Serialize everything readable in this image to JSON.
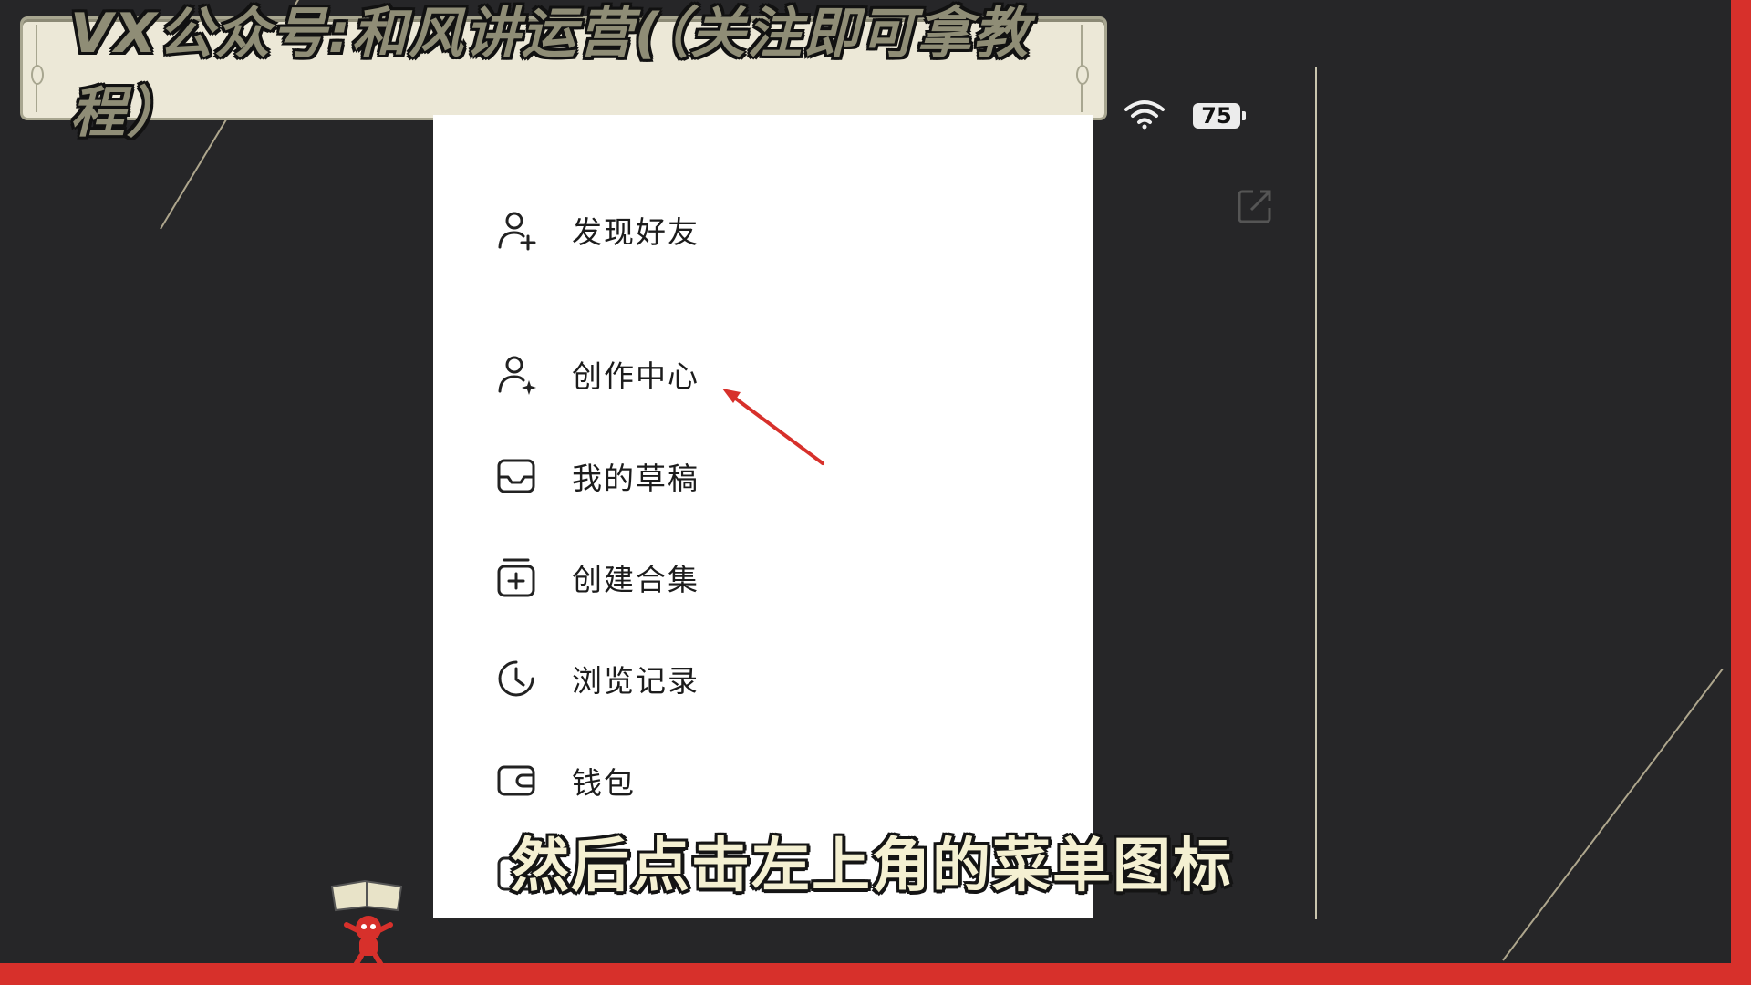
{
  "banner": {
    "text": "VX公众号:和风讲运营(（关注即可拿教程）"
  },
  "status_bar": {
    "battery_level": "75"
  },
  "menu": {
    "items": [
      {
        "label": "发现好友",
        "icon": "add-friend-icon"
      },
      {
        "label": "创作中心",
        "icon": "creator-center-icon"
      },
      {
        "label": "我的草稿",
        "icon": "drafts-inbox-icon"
      },
      {
        "label": "创建合集",
        "icon": "create-collection-icon"
      },
      {
        "label": "浏览记录",
        "icon": "history-clock-icon"
      },
      {
        "label": "钱包",
        "icon": "wallet-icon"
      }
    ]
  },
  "subtitle": {
    "text": "然后点击左上角的菜单图标"
  },
  "colors": {
    "frame": "#d7302b",
    "background": "#262628",
    "banner": "#ece8d7",
    "arrow": "#d7302b"
  }
}
